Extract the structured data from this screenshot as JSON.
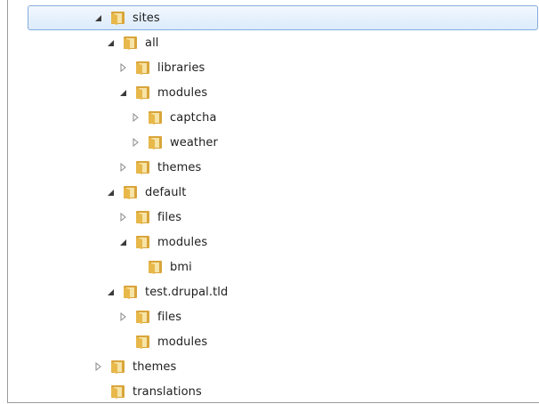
{
  "tree": {
    "items": [
      {
        "label": "sites",
        "state": "expanded",
        "selected": true
      },
      {
        "label": "all",
        "state": "expanded"
      },
      {
        "label": "libraries",
        "state": "collapsed"
      },
      {
        "label": "modules",
        "state": "expanded"
      },
      {
        "label": "captcha",
        "state": "collapsed"
      },
      {
        "label": "weather",
        "state": "collapsed"
      },
      {
        "label": "themes",
        "state": "collapsed"
      },
      {
        "label": "default",
        "state": "expanded"
      },
      {
        "label": "files",
        "state": "collapsed"
      },
      {
        "label": "modules",
        "state": "expanded"
      },
      {
        "label": "bmi",
        "state": "none"
      },
      {
        "label": "test.drupal.tld",
        "state": "expanded"
      },
      {
        "label": "files",
        "state": "collapsed"
      },
      {
        "label": "modules",
        "state": "none"
      },
      {
        "label": "themes",
        "state": "collapsed"
      },
      {
        "label": "translations",
        "state": "none"
      }
    ]
  },
  "icons": {
    "folder": "folder-icon",
    "expanded": "expanded-triangle-icon",
    "collapsed": "collapsed-triangle-icon"
  },
  "colors": {
    "selection_border": "#84acdd",
    "folder": "#e8b84a"
  }
}
